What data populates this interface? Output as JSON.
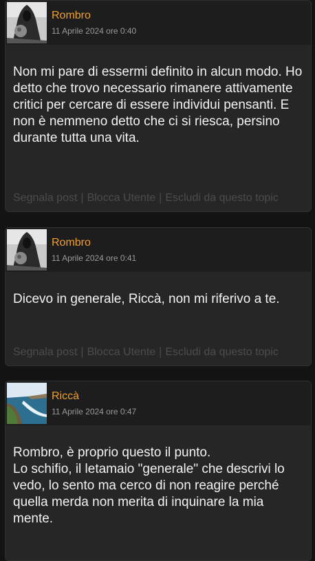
{
  "posts": [
    {
      "author": "Rombro",
      "timestamp": "11 Aprile 2024 ore 0:40",
      "avatar_icon": "hooded-figure-avatar",
      "body": "Non mi pare di essermi definito in alcun modo. Ho detto che trovo necessario rimanere attivamente critici per cercare di essere individui pensanti. E non è nemmeno detto che ci si riesca, persino durante tutta una vita.",
      "actions": {
        "report": "Segnala post",
        "block": "Blocca Utente",
        "exclude": "Escludi da questo topic",
        "separator": "|"
      }
    },
    {
      "author": "Rombro",
      "timestamp": "11 Aprile 2024 ore 0:41",
      "avatar_icon": "hooded-figure-avatar",
      "body": "Dicevo in generale, Riccà, non mi riferivo a te.",
      "actions": {
        "report": "Segnala post",
        "block": "Blocca Utente",
        "exclude": "Escludi da questo topic",
        "separator": "|"
      }
    },
    {
      "author": "Riccà",
      "timestamp": "11 Aprile 2024 ore 0:47",
      "avatar_icon": "coastline-avatar",
      "body": "Rombro, è proprio questo il punto.\nLo schifio, il letamaio \"generale\" che descrivi lo vedo, lo sento ma cerco di non reagire perché quella merda non merita di inquinare la mia mente."
    }
  ],
  "colors": {
    "username": "#f0a030",
    "timestamp": "#9a9a9a",
    "body_text": "#f2f2f2",
    "actions_text": "#4c4c4c",
    "card_bg": "#262626",
    "header_bg": "#1d1d1d",
    "page_bg": "#131313"
  }
}
